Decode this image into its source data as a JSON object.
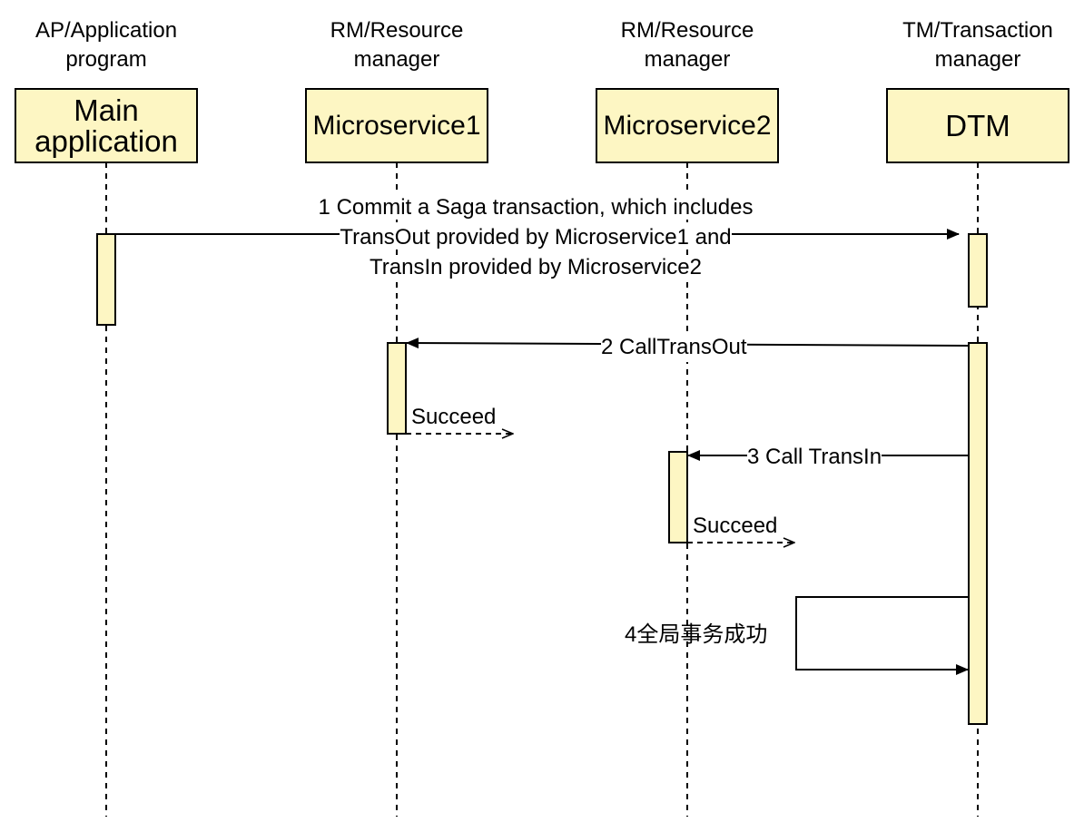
{
  "participants": [
    {
      "role": "AP/Application program",
      "name": "Main application"
    },
    {
      "role": "RM/Resource manager",
      "name": "Microservice1"
    },
    {
      "role": "RM/Resource manager",
      "name": "Microservice2"
    },
    {
      "role": "TM/Transaction manager",
      "name": "DTM"
    }
  ],
  "roles_text": {
    "ap_line1": "AP/Application",
    "ap_line2": "program",
    "rm1_line1": "RM/Resource",
    "rm1_line2": "manager",
    "rm2_line1": "RM/Resource",
    "rm2_line2": "manager",
    "tm_line1": "TM/Transaction",
    "tm_line2": "manager"
  },
  "boxes": {
    "main_line1": "Main",
    "main_line2": "application",
    "ms1": "Microservice1",
    "ms2": "Microservice2",
    "dtm": "DTM"
  },
  "messages": {
    "m1_line1": "1 Commit a Saga transaction, which includes",
    "m1_line2": "TransOut provided by Microservice1 and",
    "m1_line3": "TransIn provided by Microservice2",
    "m2": "2 CallTransOut",
    "m2_reply": "Succeed",
    "m3": "3 Call TransIn",
    "m3_reply": "Succeed",
    "m4": "4全局事务成功"
  },
  "colors": {
    "box_fill": "#fdf6c3",
    "stroke": "#000000"
  }
}
